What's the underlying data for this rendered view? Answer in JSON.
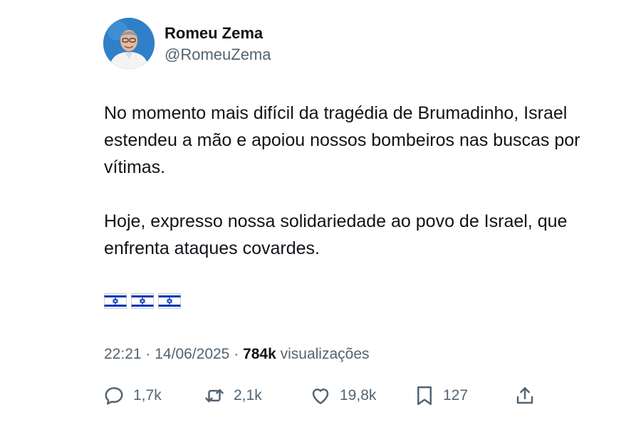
{
  "author": {
    "name": "Romeu Zema",
    "handle": "@RomeuZema"
  },
  "post": {
    "paragraph1": "No momento mais difícil da tragédia de Brumadinho, Israel estendeu a mão e apoiou nossos bombeiros nas buscas por vítimas.",
    "paragraph2": "Hoje, expresso nossa solidariedade ao povo de Israel, que enfrenta ataques covardes.",
    "emoji": [
      "flag-israel-icon",
      "flag-israel-icon",
      "flag-israel-icon"
    ]
  },
  "meta": {
    "time": "22:21",
    "separator": "·",
    "date": "14/06/2025",
    "views_count": "784k",
    "views_label": "visualizações"
  },
  "actions": {
    "replies": "1,7k",
    "reposts": "2,1k",
    "likes": "19,8k",
    "bookmarks": "127"
  },
  "colors": {
    "text_primary": "#0f1419",
    "text_secondary": "#536471",
    "flag_blue": "#0038b8",
    "avatar_bg": "#2f80c8"
  }
}
